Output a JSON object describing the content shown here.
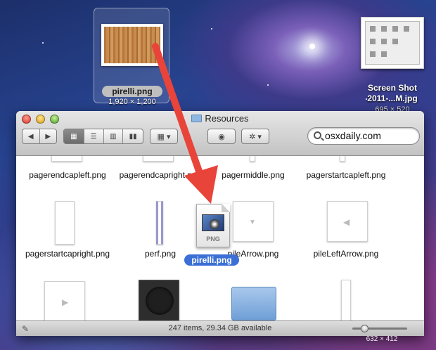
{
  "desktop": {
    "dragged_file": {
      "name": "pirelli.png",
      "dimensions": "1,920 × 1,200"
    },
    "screenshot_file": {
      "name_line1": "Screen Shot",
      "name_line2": "2011-...M.jpg",
      "dimensions": "695 × 520"
    },
    "screen_size": "632 × 412"
  },
  "window": {
    "title": "Resources",
    "search": {
      "value": "osxdaily.com",
      "placeholder": ""
    },
    "view_modes": [
      "icon",
      "list",
      "column",
      "coverflow"
    ],
    "active_view": "icon",
    "status": "247 items, 29.34 GB available"
  },
  "files": {
    "row1": [
      "pagerendcapleft.png",
      "pagerendcapright.png",
      "pagermiddle.png",
      "pagerstartcapleft.png"
    ],
    "row2": [
      "pagerstartcapright.png",
      "perf.png",
      "pileArrow.png",
      "pileLeftArrow.png"
    ]
  },
  "drag": {
    "doc_type": "PNG",
    "label": "pirelli.png"
  },
  "colors": {
    "arrow": "#e8443a",
    "selection": "#3b6fd6"
  }
}
